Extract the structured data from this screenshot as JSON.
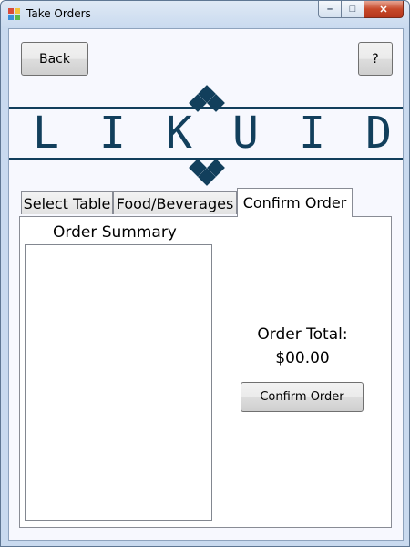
{
  "window": {
    "title": "Take Orders",
    "caption_buttons": {
      "minimize": "–",
      "maximize": "□",
      "close": "✕"
    }
  },
  "toolbar": {
    "back_label": "Back",
    "help_label": "?"
  },
  "logo": {
    "letters": [
      "L",
      "I",
      "K",
      "U",
      "I",
      "D"
    ],
    "color": "#123f5c"
  },
  "tabs": [
    {
      "label": "Select Table",
      "selected": false
    },
    {
      "label": "Food/Beverages",
      "selected": false
    },
    {
      "label": "Confirm Order",
      "selected": true
    }
  ],
  "confirm": {
    "summary_label": "Order Summary",
    "summary_items": [],
    "total_label": "Order Total:",
    "total_value": "$00.00",
    "confirm_button_label": "Confirm Order"
  },
  "icons": {
    "app": "app-window-icon",
    "logo_ornament": "diamond-icon"
  }
}
